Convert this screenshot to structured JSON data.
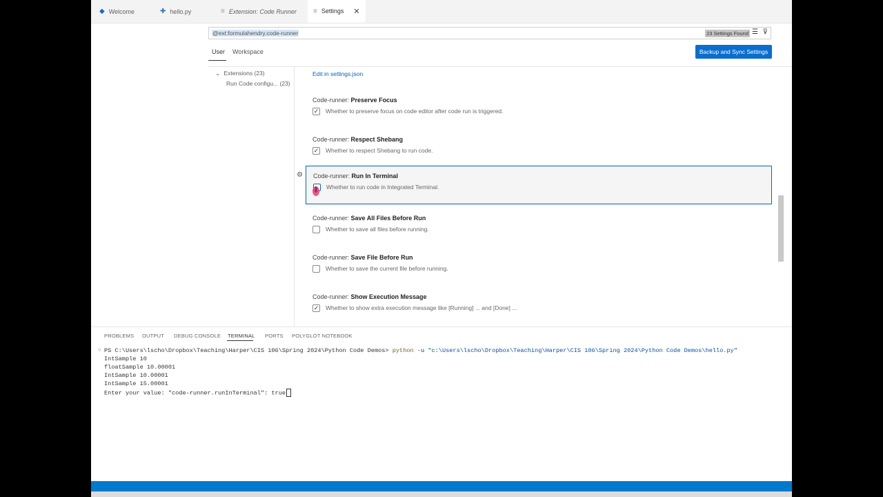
{
  "tabs": [
    {
      "label": "Welcome",
      "icon": "vscode-logo-icon"
    },
    {
      "label": "hello.py",
      "icon": "python-file-icon"
    },
    {
      "label": "Extension: Code Runner",
      "icon": "extension-icon"
    },
    {
      "label": "Settings",
      "icon": "settings-file-icon",
      "close": "✕"
    }
  ],
  "search": {
    "query": "@ext:formulahendry.code-runner",
    "count": "23 Settings Found"
  },
  "scopes": {
    "user": "User",
    "workspace": "Workspace"
  },
  "sync_button": "Backup and Sync Settings",
  "toc": {
    "group": "Extensions",
    "group_count": "(23)",
    "item": "Run Code configu...",
    "item_count": "(23)"
  },
  "edit_link": "Edit in settings.json",
  "settings": [
    {
      "prefix": "Code-runner: ",
      "name": "Preserve Focus",
      "desc": "Whether to preserve focus on code editor after code run is triggered.",
      "checked": true
    },
    {
      "prefix": "Code-runner: ",
      "name": "Respect Shebang",
      "desc": "Whether to respect Shebang to run code.",
      "checked": true
    },
    {
      "prefix": "Code-runner: ",
      "name": "Run In Terminal",
      "desc": "Whether to run code in Integrated Terminal.",
      "checked": false
    },
    {
      "prefix": "Code-runner: ",
      "name": "Save All Files Before Run",
      "desc": "Whether to save all files before running.",
      "checked": false
    },
    {
      "prefix": "Code-runner: ",
      "name": "Save File Before Run",
      "desc": "Whether to save the current file before running.",
      "checked": false
    },
    {
      "prefix": "Code-runner: ",
      "name": "Show Execution Message",
      "desc": "Whether to show extra execution message like [Running] ... and [Done] ...",
      "checked": true
    }
  ],
  "panel_tabs": [
    "PROBLEMS",
    "OUTPUT",
    "DEBUG CONSOLE",
    "TERMINAL",
    "PORTS",
    "POLYGLOT NOTEBOOK"
  ],
  "terminal": {
    "prompt": "PS C:\\Users\\lscho\\Dropbox\\Teaching\\Harper\\CIS 106\\Spring 2024\\Python Code Demos> ",
    "command": "python",
    "args": " -u ",
    "path": "\"c:\\Users\\lscho\\Dropbox\\Teaching\\Harper\\CIS 106\\Spring 2024\\Python Code Demos\\hello.py\"",
    "lines": [
      "IntSample 10",
      "floatSample 10.00001",
      "IntSample 10.00001",
      "IntSample 15.00001"
    ],
    "input_line": "Enter your value: \"code-runner.runInTerminal\": true"
  },
  "colors": {
    "accent": "#007acc",
    "button": "#0a6ecf",
    "focus_border": "#0066b8",
    "link": "#0064bf"
  }
}
